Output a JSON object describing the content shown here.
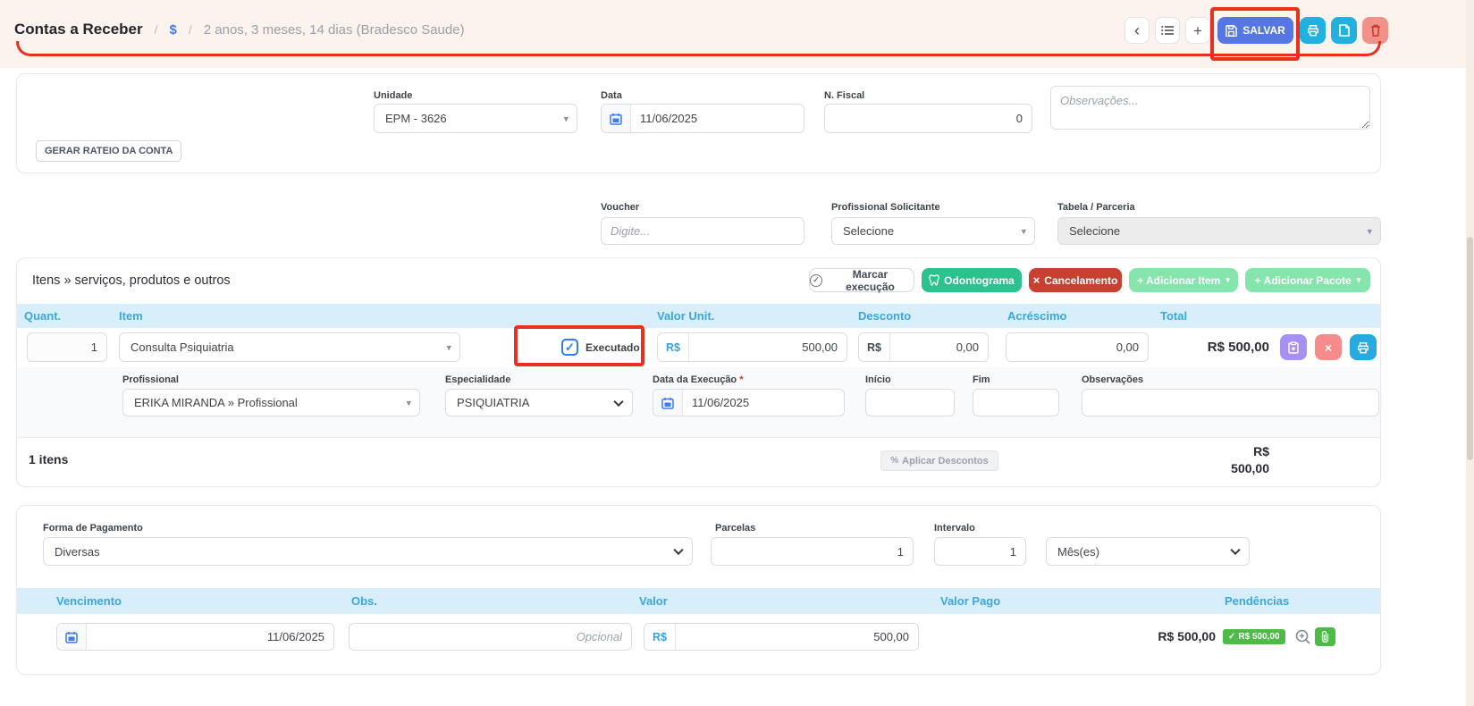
{
  "colors": {
    "accent_blue": "#5677e2",
    "cyan": "#22b1df",
    "red_annotation": "#e8301f",
    "table_head_bg": "#d9eefb",
    "table_head_text": "#3ba6e0",
    "green": "#2cc28e",
    "mint": "#85e5ad",
    "brick": "#c8402f",
    "badge_green": "#4eba48"
  },
  "icons": {
    "dollar": "$",
    "chevron_left": "‹",
    "plus": "+",
    "caret": "▾",
    "close": "×",
    "check": "✓",
    "percent": "%",
    "asterisk": "*"
  },
  "header": {
    "title": "Contas a Receber",
    "sep1": "/",
    "sep2": "/",
    "breadcrumb": "2 anos, 3 meses, 14 dias (Bradesco Saude)",
    "save_label": "SALVAR"
  },
  "account_card": {
    "unidade_label": "Unidade",
    "unidade_value": "EPM - 3626",
    "data_label": "Data",
    "data_value": "11/06/2025",
    "nfiscal_label": "N. Fiscal",
    "nfiscal_value": "0",
    "observacoes_placeholder": "Observações...",
    "gerar_rateio_label": "GERAR RATEIO DA CONTA"
  },
  "voucher_row": {
    "voucher_label": "Voucher",
    "voucher_placeholder": "Digite...",
    "prof_solicitante_label": "Profissional Solicitante",
    "prof_solicitante_value": "Selecione",
    "tabela_label": "Tabela / Parceria",
    "tabela_value": "Selecione"
  },
  "items_section": {
    "title": "Itens » serviços, produtos e outros",
    "marcar_execucao": "Marcar execução",
    "odontograma": "Odontograma",
    "cancelamento": "Cancelamento",
    "adicionar_item": "+ Adicionar Item",
    "adicionar_pacote": "+ Adicionar Pacote",
    "columns": {
      "quant": "Quant.",
      "item": "Item",
      "valor_unit": "Valor Unit.",
      "desconto": "Desconto",
      "acrescimo": "Acréscimo",
      "total": "Total"
    },
    "row": {
      "quant": "1",
      "item": "Consulta Psiquiatria",
      "executado_label": "Executado",
      "currency": "R$",
      "valor_unit": "500,00",
      "desconto": "0,00",
      "acrescimo": "0,00",
      "total": "R$ 500,00"
    },
    "detail": {
      "profissional_label": "Profissional",
      "profissional_value": "ERIKA MIRANDA » Profissional",
      "especialidade_label": "Especialidade",
      "especialidade_value": "PSIQUIATRIA",
      "data_execucao_label": "Data da Execução",
      "data_execucao_value": "11/06/2025",
      "inicio_label": "Início",
      "fim_label": "Fim",
      "observacoes_label": "Observações"
    },
    "footer": {
      "items_count": "1 itens",
      "aplicar_descontos": "Aplicar Descontos",
      "total_currency": "R$",
      "total_value": "500,00"
    }
  },
  "payment_section": {
    "forma_label": "Forma de Pagamento",
    "forma_value": "Diversas",
    "parcelas_label": "Parcelas",
    "parcelas_value": "1",
    "intervalo_label": "Intervalo",
    "intervalo_value": "1",
    "periodo_value": "Mês(es)",
    "columns": {
      "vencimento": "Vencimento",
      "obs": "Obs.",
      "valor": "Valor",
      "valor_pago": "Valor Pago",
      "pendencias": "Pendências"
    },
    "row": {
      "vencimento": "11/06/2025",
      "obs_placeholder": "Opcional",
      "currency": "R$",
      "valor": "500,00",
      "valor_pago": "R$ 500,00",
      "badge": "R$ 500,00"
    }
  }
}
